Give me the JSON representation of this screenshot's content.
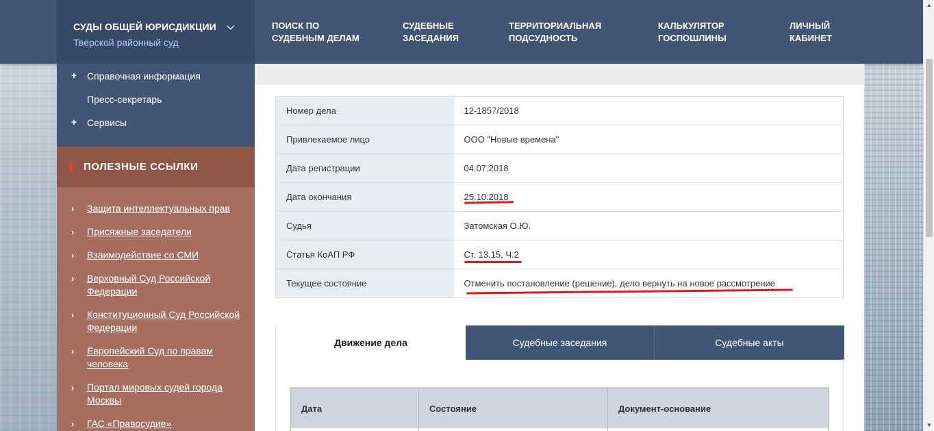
{
  "header": {
    "court_group": "СУДЫ ОБЩЕЙ ЮРИСДИКЦИИ",
    "court_name": "Тверской районный суд",
    "nav": [
      {
        "line1": "ПОИСК ПО",
        "line2": "СУДЕБНЫМ ДЕЛАМ"
      },
      {
        "line1": "СУДЕБНЫЕ",
        "line2": "ЗАСЕДАНИЯ"
      },
      {
        "line1": "ТЕРРИТОРИАЛЬНАЯ",
        "line2": "ПОДСУДНОСТЬ"
      },
      {
        "line1": "КАЛЬКУЛЯТОР",
        "line2": "ГОСПОШЛИНЫ"
      },
      {
        "line1": "ЛИЧНЫЙ",
        "line2": "КАБИНЕТ"
      }
    ]
  },
  "sidebar": {
    "items": [
      {
        "plus": "+",
        "label": "Справочная информация"
      },
      {
        "plus": "",
        "label": "Пресс-секретарь"
      },
      {
        "plus": "+",
        "label": "Сервисы"
      }
    ],
    "links_title": "ПОЛЕЗНЫЕ ССЫЛКИ",
    "links": [
      "Защита интеллектуальных прав",
      "Присяжные заседатели",
      "Взаимодействие со СМИ",
      "Верховный Суд Российской Федерации",
      "Конституционный Суд Российской Федерации",
      "Европейский Суд по правам человека",
      "Портал мировых судей города Москвы",
      "ГАС «Правосудие»"
    ]
  },
  "case": {
    "rows": [
      {
        "key": "Номер дела",
        "value": "12-1857/2018"
      },
      {
        "key": "Привлекаемое лицо",
        "value": "ООО \"Новые времена\""
      },
      {
        "key": "Дата регистрации",
        "value": "04.07.2018"
      },
      {
        "key": "Дата окончания",
        "value": "25.10.2018"
      },
      {
        "key": "Судья",
        "value": "Затомская О.Ю."
      },
      {
        "key": "Статья КоАП РФ",
        "value": "Ст. 13.15, Ч.2"
      },
      {
        "key": "Текущее состояние",
        "value": "Отменить постановление (решение), дело вернуть на новое рассмотрение"
      }
    ]
  },
  "tabs": [
    "Движение дела",
    "Судебные заседания",
    "Судебные акты"
  ],
  "movement_table": {
    "columns": [
      "Дата",
      "Состояние",
      "Документ-основание"
    ]
  },
  "colors": {
    "nav_bg": "#415574",
    "links_header_bg": "#8e5747",
    "links_body_bg": "#a66e5f",
    "annotation_red": "#e0181d"
  }
}
